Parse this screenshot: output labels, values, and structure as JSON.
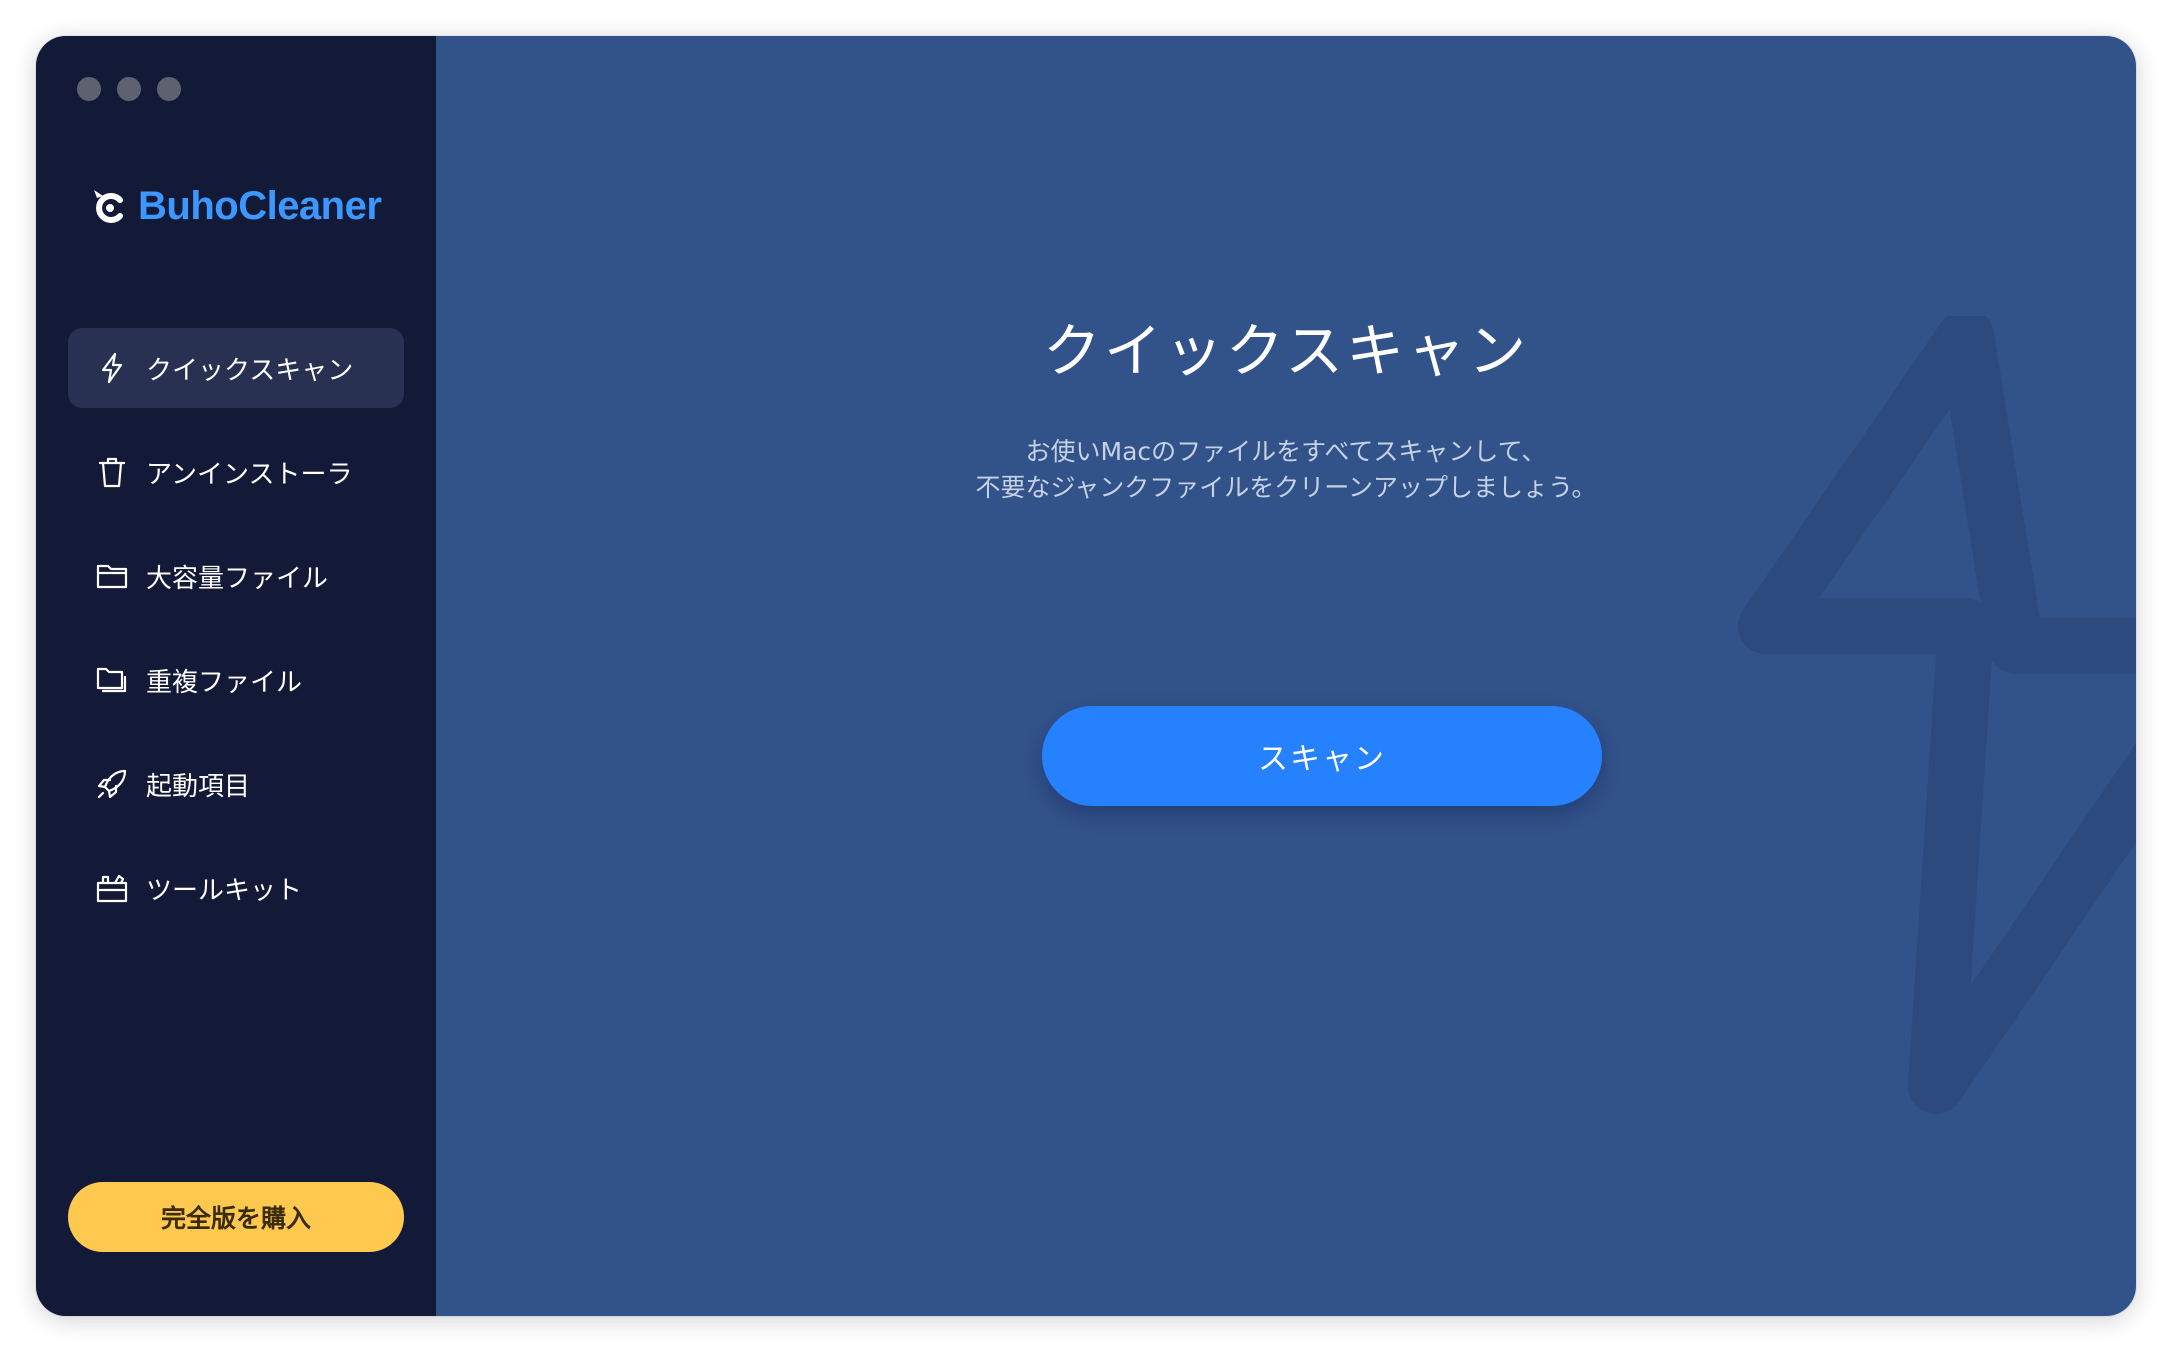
{
  "app": {
    "name": "BuhoCleaner",
    "brand_color": "#3c98ff"
  },
  "window_controls": [
    "close",
    "minimize",
    "zoom"
  ],
  "sidebar": {
    "items": [
      {
        "label": "クイックスキャン",
        "icon": "lightning-icon",
        "active": true
      },
      {
        "label": "アンインストーラ",
        "icon": "trash-icon",
        "active": false
      },
      {
        "label": "大容量ファイル",
        "icon": "folder-icon",
        "active": false
      },
      {
        "label": "重複ファイル",
        "icon": "duplicate-folder-icon",
        "active": false
      },
      {
        "label": "起動項目",
        "icon": "rocket-icon",
        "active": false
      },
      {
        "label": "ツールキット",
        "icon": "toolbox-icon",
        "active": false
      }
    ],
    "buy_label": "完全版を購入",
    "buy_color": "#ffc94f"
  },
  "main": {
    "title": "クイックスキャン",
    "description_line1": "お使いMacのファイルをすべてスキャンして、",
    "description_line2": "不要なジャンクファイルをクリーンアップしましょう。",
    "scan_label": "スキャン",
    "scan_color": "#2681ff",
    "background_color": "#32528a"
  }
}
